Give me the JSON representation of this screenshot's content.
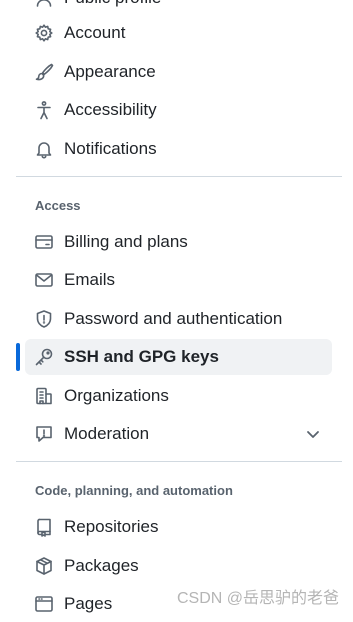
{
  "partial_top_item": {
    "label": "Public profile",
    "icon": "person-icon"
  },
  "group1": [
    {
      "label": "Account",
      "icon": "gear-icon"
    },
    {
      "label": "Appearance",
      "icon": "paintbrush-icon"
    },
    {
      "label": "Accessibility",
      "icon": "accessibility-icon"
    },
    {
      "label": "Notifications",
      "icon": "bell-icon"
    }
  ],
  "access": {
    "heading": "Access",
    "items": [
      {
        "label": "Billing and plans",
        "icon": "credit-card-icon"
      },
      {
        "label": "Emails",
        "icon": "mail-icon"
      },
      {
        "label": "Password and authentication",
        "icon": "shield-icon"
      },
      {
        "label": "SSH and GPG keys",
        "icon": "key-icon",
        "active": true
      },
      {
        "label": "Organizations",
        "icon": "organization-icon"
      },
      {
        "label": "Moderation",
        "icon": "report-icon",
        "expandable": true
      }
    ]
  },
  "code": {
    "heading": "Code, planning, and automation",
    "items": [
      {
        "label": "Repositories",
        "icon": "repo-icon"
      },
      {
        "label": "Packages",
        "icon": "package-icon"
      },
      {
        "label": "Pages",
        "icon": "browser-icon"
      }
    ]
  },
  "watermark": "CSDN @岳思驴的老爸",
  "colors": {
    "accent": "#0969da",
    "active_bg": "#f0f2f4",
    "text": "#1f2328",
    "muted": "#59636e",
    "divider": "#d1d9e0"
  }
}
